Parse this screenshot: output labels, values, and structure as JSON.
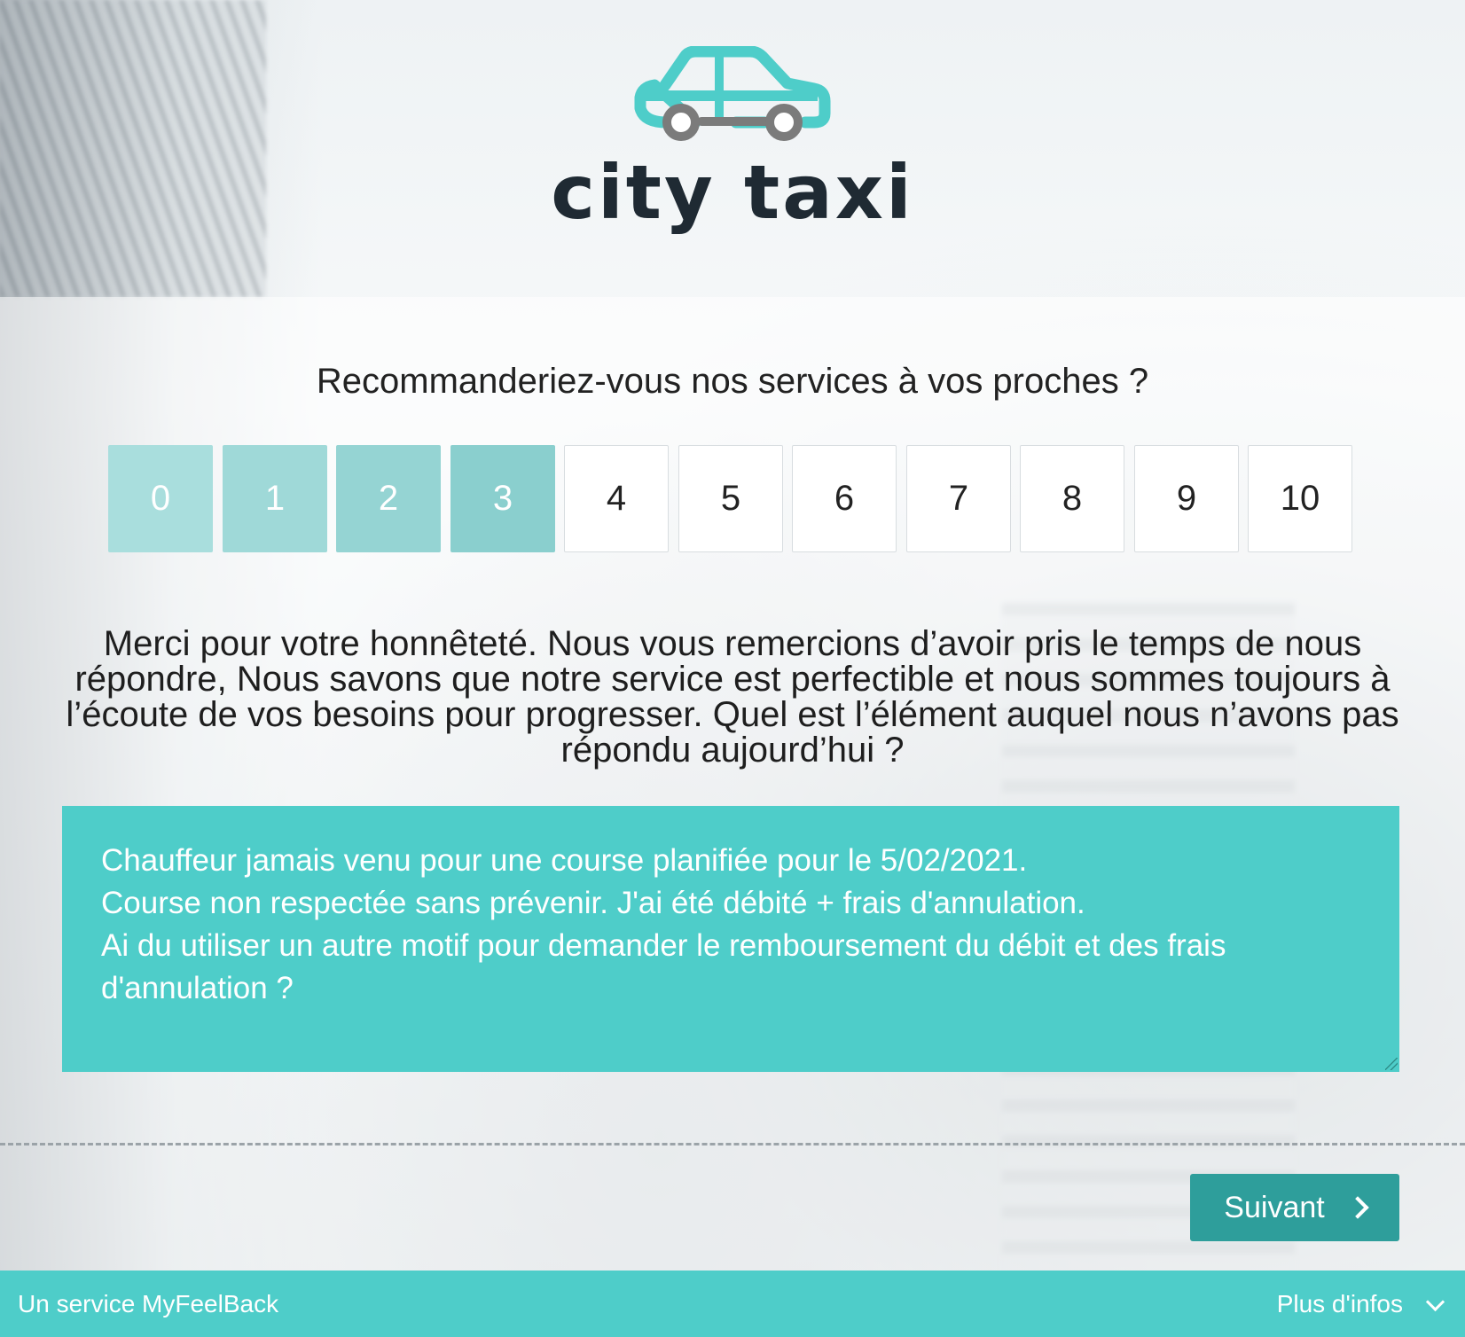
{
  "brand": {
    "logo_icon": "taxi-car-icon",
    "name": "city taxi",
    "colors": {
      "teal": "#4ecdc9",
      "wheel_grey": "#7b7b7b",
      "text": "#1f2a33"
    }
  },
  "survey": {
    "question": "Recommanderiez-vous nos services à vos proches ?",
    "scale": {
      "options": [
        {
          "label": "0",
          "selected": true,
          "color": "#a9dedd"
        },
        {
          "label": "1",
          "selected": true,
          "color": "#9fd9d8"
        },
        {
          "label": "2",
          "selected": true,
          "color": "#95d4d3"
        },
        {
          "label": "3",
          "selected": true,
          "color": "#8acfce"
        },
        {
          "label": "4",
          "selected": false
        },
        {
          "label": "5",
          "selected": false
        },
        {
          "label": "6",
          "selected": false
        },
        {
          "label": "7",
          "selected": false
        },
        {
          "label": "8",
          "selected": false
        },
        {
          "label": "9",
          "selected": false
        },
        {
          "label": "10",
          "selected": false
        }
      ],
      "selected_value": 3
    },
    "followup_text": "Merci pour votre honnêteté. Nous vous remercions d’avoir pris le temps de nous répondre, Nous savons que notre service est perfectible et nous sommes toujours à l’écoute de vos besoins pour progresser. Quel est l’élément auquel nous n’avons pas répondu aujourd’hui ?",
    "answer_lines": [
      "Chauffeur jamais venu pour une course planifiée pour le 5/02/2021.",
      "Course non respectée sans prévenir. J'ai été débité + frais d'annulation.",
      "Ai du utiliser un autre motif pour demander le remboursement du débit et des frais d'annulation ?"
    ],
    "next_button": {
      "label": "Suivant",
      "icon": "chevron-right-icon",
      "color": "#2e9e9b"
    }
  },
  "footer": {
    "left_text": "Un service MyFeelBack",
    "right_text": "Plus d'infos",
    "right_icon": "chevron-down-icon"
  }
}
